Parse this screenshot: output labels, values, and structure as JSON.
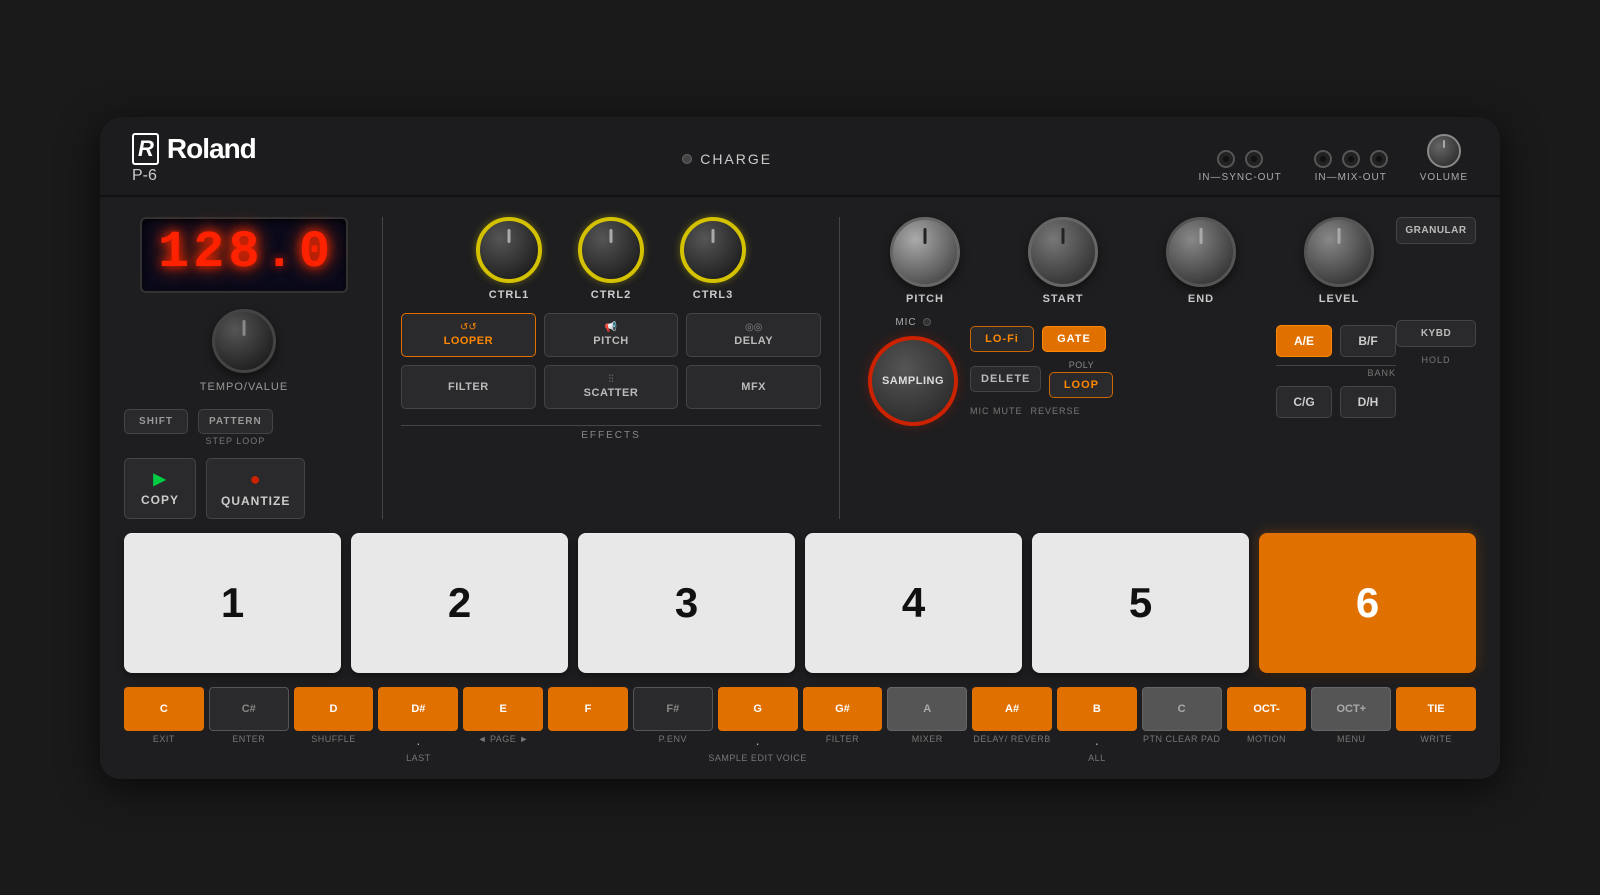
{
  "brand": {
    "logo": "Roland",
    "model": "P-6"
  },
  "top_bar": {
    "charge_label": "CHARGE",
    "in_sync_out_label": "IN—SYNC-OUT",
    "in_mix_out_label": "IN—MIX-OUT",
    "volume_label": "VOLUME"
  },
  "display": {
    "value": "128.0",
    "digits": [
      "1",
      "2",
      "8",
      ".",
      "0"
    ]
  },
  "knobs": {
    "tempo_label": "TEMPO/VALUE",
    "ctrl1_label": "CTRL1",
    "ctrl2_label": "CTRL2",
    "ctrl3_label": "CTRL3",
    "pitch_label": "PITCH",
    "start_label": "START",
    "end_label": "END",
    "level_label": "LEVEL"
  },
  "effects": {
    "section_label": "EFFECTS",
    "buttons": [
      {
        "label": "LOOPER",
        "icon": "↺",
        "active": true
      },
      {
        "label": "PITCH",
        "icon": "📢",
        "active": false
      },
      {
        "label": "DELAY",
        "icon": "◎",
        "active": false
      },
      {
        "label": "FILTER",
        "icon": "",
        "active": false
      },
      {
        "label": "SCATTER",
        "icon": "⫶",
        "active": false
      },
      {
        "label": "MFX",
        "icon": "",
        "active": false
      }
    ]
  },
  "buttons": {
    "shift": "SHIFT",
    "pattern": "PATTERN",
    "step_loop": "STEP LOOP",
    "copy": "COPY",
    "quantize": "QUANTIZE",
    "granular": "GRANULAR",
    "kybd": "KYBD",
    "hold": "HOLD",
    "mic": "MIC",
    "sampling": "SAMPLING",
    "lo_fi": "LO-Fi",
    "gate": "GATE",
    "delete": "DELETE",
    "loop": "LOOP",
    "poly": "POLY",
    "mic_mute": "MIC MUTE",
    "reverse": "REVERSE",
    "bank": "BANK"
  },
  "bank_buttons": [
    {
      "label": "A/E",
      "active": true
    },
    {
      "label": "B/F",
      "active": false
    },
    {
      "label": "C/G",
      "active": false
    },
    {
      "label": "D/H",
      "active": false
    }
  ],
  "pads": [
    {
      "number": "1",
      "active": false
    },
    {
      "number": "2",
      "active": false
    },
    {
      "number": "3",
      "active": false
    },
    {
      "number": "4",
      "active": false
    },
    {
      "number": "5",
      "active": false
    },
    {
      "number": "6",
      "active": true
    }
  ],
  "piano_keys": [
    {
      "note": "C",
      "label": "EXIT",
      "type": "orange",
      "dot": false
    },
    {
      "note": "C#",
      "label": "ENTER",
      "type": "dark-gray",
      "dot": false
    },
    {
      "note": "D",
      "label": "SHUFFLE",
      "type": "orange",
      "dot": false
    },
    {
      "note": "D#",
      "label": "LAST",
      "type": "orange",
      "dot": true
    },
    {
      "note": "E",
      "label": "◄ PAGE",
      "type": "orange",
      "dot": false
    },
    {
      "note": "F",
      "label": "►",
      "type": "orange",
      "dot": false
    },
    {
      "note": "F#",
      "label": "P.ENV",
      "type": "dark-gray",
      "dot": false
    },
    {
      "note": "G",
      "label": "SAMPLE EDIT VOICE",
      "type": "orange",
      "dot": true
    },
    {
      "note": "G#",
      "label": "FILTER",
      "type": "orange",
      "dot": false
    },
    {
      "note": "A",
      "label": "MIXER",
      "type": "white-off",
      "dot": false
    },
    {
      "note": "A#",
      "label": "DELAY/ REVERB",
      "type": "orange",
      "dot": false
    },
    {
      "note": "B",
      "label": "ALL",
      "type": "orange",
      "dot": true
    },
    {
      "note": "C2",
      "label": "PTN CLEAR PAD",
      "type": "white-off",
      "dot": false
    },
    {
      "note": "OCT-",
      "label": "MOTION",
      "type": "orange",
      "dot": false
    },
    {
      "note": "OCT+",
      "label": "MENU",
      "type": "white-off",
      "dot": false
    },
    {
      "note": "TIE",
      "label": "WRITE",
      "type": "orange",
      "dot": false
    }
  ]
}
